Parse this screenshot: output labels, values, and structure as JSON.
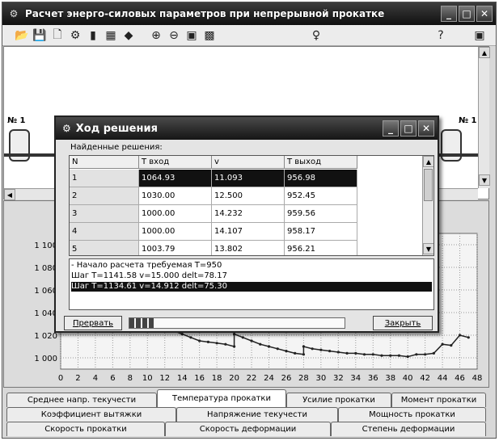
{
  "window": {
    "title": "Расчет энерго-силовых параметров при непрерывной прокатке"
  },
  "toolbar": {
    "icons": [
      "open-icon",
      "save-icon",
      "new-icon",
      "tree-icon",
      "bars-icon",
      "table-icon",
      "diamond-icon",
      "zoom-in-icon",
      "zoom-out-icon",
      "chart-icon",
      "grid-icon",
      "pin-icon",
      "help-icon",
      "exit-icon"
    ],
    "glyphs": [
      "📂",
      "💾",
      "🗋",
      "⚙",
      "▮",
      "▦",
      "◆",
      "⊕",
      "⊖",
      "▣",
      "▩",
      "♀",
      "?",
      "▣"
    ]
  },
  "stands": {
    "left_label": "№ 1",
    "right_label": "№ 1"
  },
  "dialog": {
    "title": "Ход решения",
    "found_label": "Найденные решения:",
    "columns": [
      "N",
      "T вход",
      "v",
      "T выход"
    ],
    "rows": [
      {
        "n": "1",
        "tin": "1064.93",
        "v": "11.093",
        "tout": "956.98"
      },
      {
        "n": "2",
        "tin": "1030.00",
        "v": "12.500",
        "tout": "952.45"
      },
      {
        "n": "3",
        "tin": "1000.00",
        "v": "14.232",
        "tout": "959.56"
      },
      {
        "n": "4",
        "tin": "1000.00",
        "v": "14.107",
        "tout": "958.17"
      },
      {
        "n": "5",
        "tin": "1003.79",
        "v": "13.802",
        "tout": "956.21"
      }
    ],
    "log": [
      "- Начало расчета требуемая T=950",
      "Шаг T=1141.58 v=15.000 delt=78.17",
      "Шаг T=1134.61 v=14.912 delt=75.30"
    ],
    "abort_label": "Прервать",
    "close_label": "Закрыть",
    "progress": 0.12
  },
  "chart_data": {
    "type": "line",
    "y_ticks": [
      "1 100",
      "1 080",
      "1 060",
      "1 040",
      "1 020",
      "1 000"
    ],
    "x_ticks": [
      "0",
      "2",
      "4",
      "6",
      "8",
      "10",
      "12",
      "14",
      "16",
      "18",
      "20",
      "22",
      "24",
      "26",
      "28",
      "30",
      "32",
      "34",
      "36",
      "38",
      "40",
      "42",
      "44",
      "46",
      "48"
    ],
    "xlim": [
      0,
      48
    ],
    "ylim": [
      990,
      1110
    ],
    "grid": true,
    "series": [
      {
        "x": [
          10,
          11,
          12,
          13,
          14,
          15,
          16,
          17,
          18,
          19,
          20,
          20,
          21,
          22,
          23,
          24,
          25,
          26,
          27,
          28,
          28,
          29,
          30,
          31,
          32,
          33,
          34,
          35,
          36,
          37,
          38,
          39,
          40,
          41,
          42,
          43,
          44,
          45,
          46,
          47
        ],
        "y": [
          1033,
          1030,
          1027,
          1024,
          1021,
          1018,
          1015,
          1014,
          1013,
          1012,
          1010,
          1021,
          1018,
          1015,
          1012,
          1010,
          1008,
          1006,
          1004,
          1003,
          1010,
          1008,
          1007,
          1006,
          1005,
          1004,
          1004,
          1003,
          1003,
          1002,
          1002,
          1002,
          1001,
          1003,
          1003,
          1004,
          1012,
          1011,
          1020,
          1018
        ]
      }
    ],
    "color": "#222222"
  },
  "tabs": {
    "row1": [
      "Среднее напр. текучести",
      "Температура прокатки",
      "Усилие прокатки",
      "Момент прокатки"
    ],
    "row2": [
      "Коэффициент вытяжки",
      "Напряжение текучести",
      "Мощность прокатки"
    ],
    "row3": [
      "Скорость прокатки",
      "Скорость деформации",
      "Степень деформации"
    ],
    "active": "Температура прокатки"
  }
}
